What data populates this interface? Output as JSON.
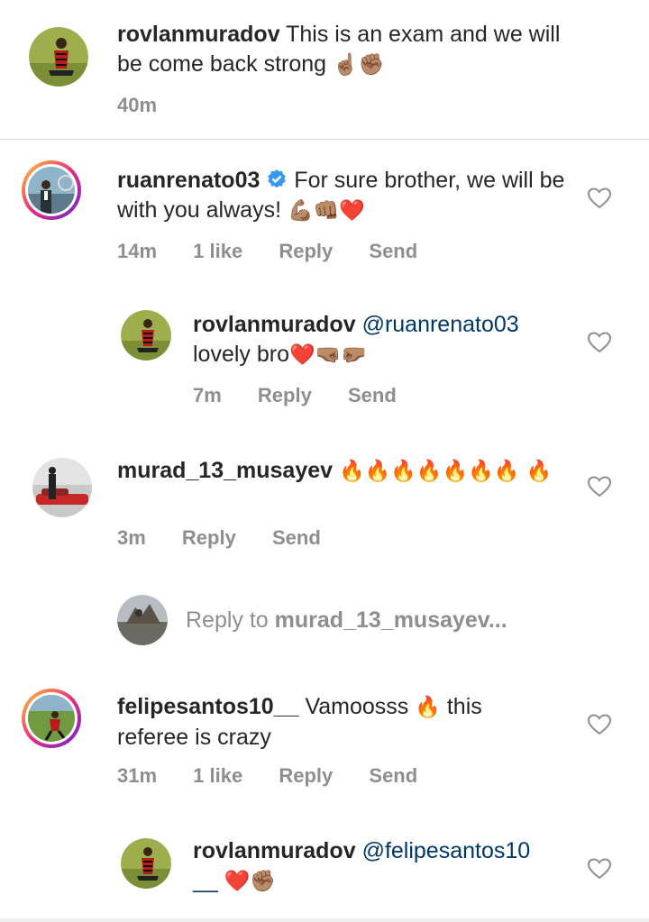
{
  "caption": {
    "username": "rovlanmuradov",
    "text": "This is an exam and we will be come back strong",
    "emoji": "☝🏽✊🏽",
    "time": "40m"
  },
  "comments": [
    {
      "username": "ruanrenato03",
      "verified": true,
      "text": "For sure brother, we will be with you always!",
      "emoji": "💪🏽👊🏽❤️",
      "time": "14m",
      "likes": "1 like",
      "reply": "Reply",
      "send": "Send"
    },
    {
      "username": "rovlanmuradov",
      "mention": "@ruanrenato03",
      "text": "lovely bro",
      "emoji": "❤️🤜🏽🤛🏽",
      "time": "7m",
      "reply": "Reply",
      "send": "Send"
    },
    {
      "username": "murad_13_musayev",
      "text": "",
      "emoji": "🔥🔥🔥🔥🔥🔥🔥 🔥",
      "time": "3m",
      "reply": "Reply",
      "send": "Send"
    },
    {
      "username": "felipesantos10__",
      "text_before": "Vamoosss",
      "emoji": "🔥",
      "text_after": "this referee is crazy",
      "time": "31m",
      "likes": "1 like",
      "reply": "Reply",
      "send": "Send"
    },
    {
      "username": "rovlanmuradov",
      "mention": "@felipesantos10",
      "mention_cont": "__",
      "emoji": "❤️✊🏽"
    }
  ],
  "reply_input": {
    "prefix": "Reply to",
    "target": "murad_13_musayev..."
  },
  "colors": {
    "text": "#262626",
    "meta": "#8e8e8e",
    "mention": "#00376b",
    "verified": "#3897f0"
  }
}
